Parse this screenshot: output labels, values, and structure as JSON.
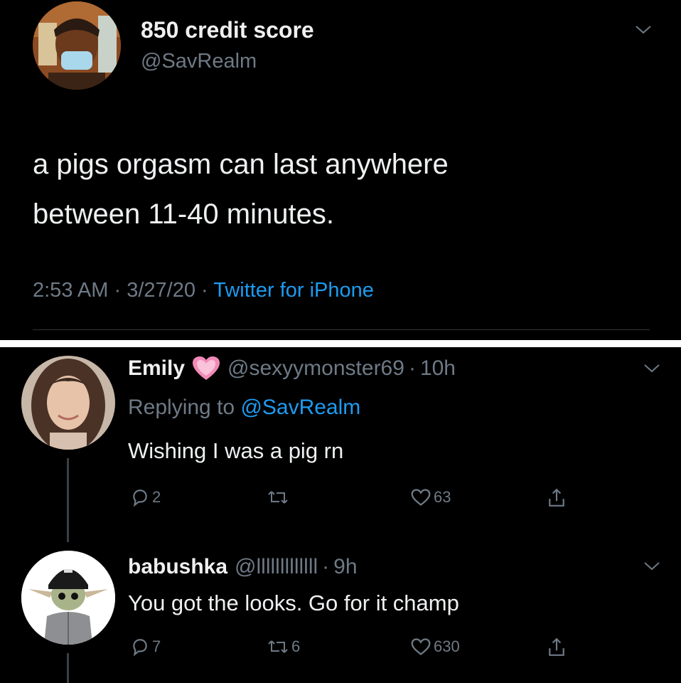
{
  "tweet": {
    "display_name": "850 credit score",
    "handle": "@SavRealm",
    "text_line1": "a pigs orgasm can last anywhere",
    "text_line2": "between 11-40 minutes.",
    "time": "2:53 AM",
    "sep": "·",
    "date": "3/27/20",
    "source": "Twitter for iPhone"
  },
  "replies": [
    {
      "display_name": "Emily",
      "handle": "@sexyymonster69",
      "sep": "·",
      "age": "10h",
      "replying_prefix": "Replying to",
      "replying_to": "@SavRealm",
      "text": "Wishing I was a pig rn",
      "reply_count": "2",
      "retweet_count": "",
      "like_count": "63"
    },
    {
      "display_name": "babushka",
      "handle": "@lllllllllllll",
      "sep": "·",
      "age": "9h",
      "text": "You got the looks. Go for it champ",
      "reply_count": "7",
      "retweet_count": "6",
      "like_count": "630"
    }
  ],
  "colors": {
    "background": "#000000",
    "text": "#e7e9ea",
    "muted": "#6e7a86",
    "link": "#1d9bf0",
    "heart_emoji": "#f28ab8"
  },
  "icons": [
    "chevron-down-icon",
    "heart-emoji-icon",
    "reply-icon",
    "retweet-icon",
    "like-icon",
    "share-icon"
  ]
}
